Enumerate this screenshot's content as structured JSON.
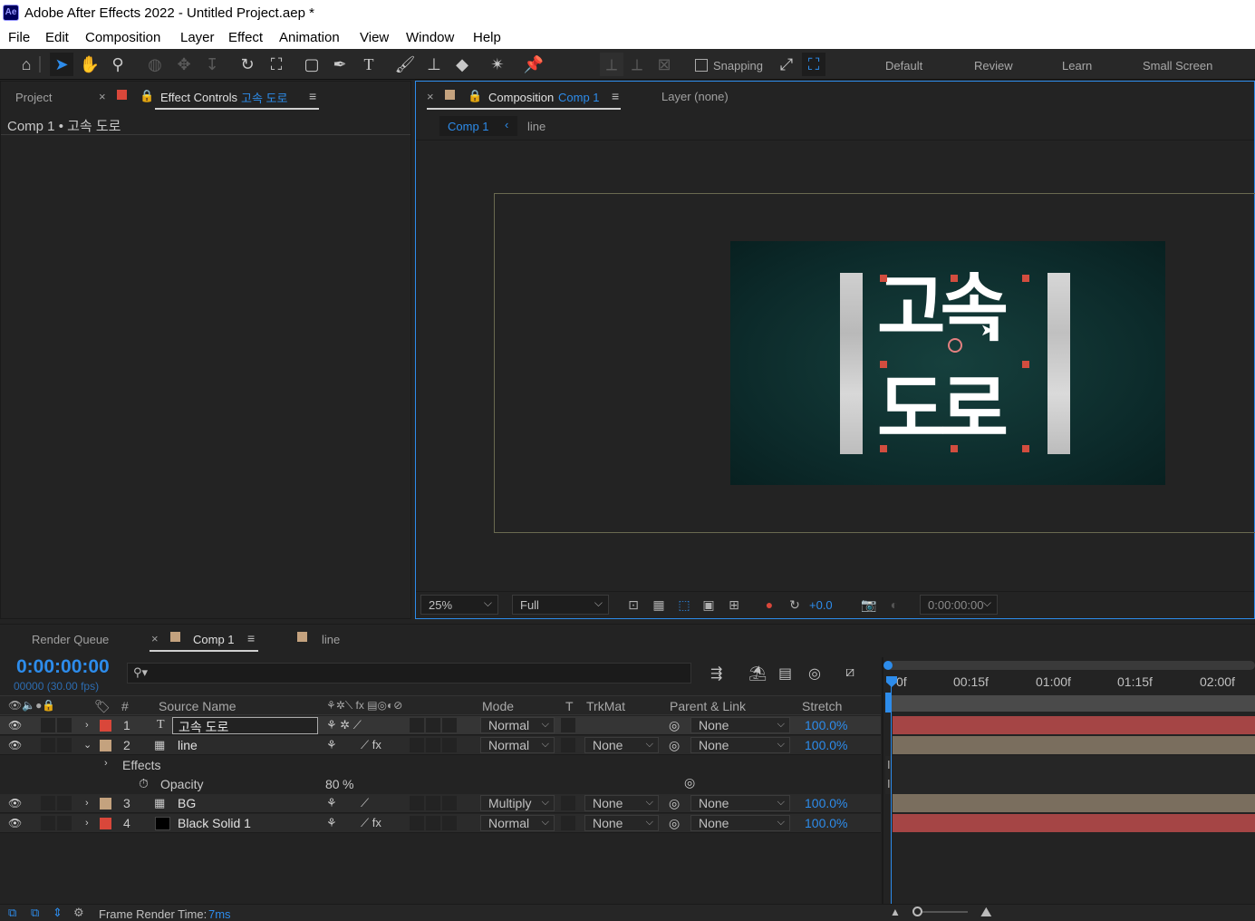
{
  "app": {
    "title": "Adobe After Effects 2022 - Untitled Project.aep *",
    "logo": "Ae"
  },
  "menu": [
    "File",
    "Edit",
    "Composition",
    "Layer",
    "Effect",
    "Animation",
    "View",
    "Window",
    "Help"
  ],
  "toolbar": {
    "snapping_label": "Snapping",
    "workspaces": [
      "Default",
      "Review",
      "Learn",
      "Small Screen"
    ]
  },
  "left_panel": {
    "tab_project": "Project",
    "tab_effect_controls": "Effect Controls",
    "effect_layer": "고속 도로",
    "breadcrumb": "Comp 1 • 고속 도로"
  },
  "comp_panel": {
    "tab_label": "Composition",
    "tab_comp": "Comp 1",
    "layer_tab": "Layer (none)",
    "crumb_active": "Comp 1",
    "crumb_next": "line",
    "canvas_text_line1": "고속",
    "canvas_text_line2": "도로",
    "zoom": "25%",
    "resolution": "Full",
    "exposure": "+0.0",
    "timecode": "0:00:00:00"
  },
  "timeline": {
    "tab_render_queue": "Render Queue",
    "tab_comp1": "Comp 1",
    "tab_line": "line",
    "current_time": "0:00:00:00",
    "frame_info": "00000 (30.00 fps)",
    "headers": {
      "num": "#",
      "source": "Source Name",
      "mode": "Mode",
      "t": "T",
      "trkmat": "TrkMat",
      "parent": "Parent & Link",
      "stretch": "Stretch"
    },
    "ruler": [
      "0f",
      "00:15f",
      "01:00f",
      "01:15f",
      "02:00f"
    ],
    "layers": [
      {
        "num": "1",
        "name": "고속 도로",
        "mode": "Normal",
        "trkmat": "",
        "parent": "None",
        "stretch": "100.0%",
        "color": "#d9473a",
        "type": "T"
      },
      {
        "num": "2",
        "name": "line",
        "mode": "Normal",
        "trkmat": "None",
        "parent": "None",
        "stretch": "100.0%",
        "color": "#c4a27e",
        "type": "comp"
      },
      {
        "num": "3",
        "name": "BG",
        "mode": "Multiply",
        "trkmat": "None",
        "parent": "None",
        "stretch": "100.0%",
        "color": "#c4a27e",
        "type": "comp"
      },
      {
        "num": "4",
        "name": "Black Solid 1",
        "mode": "Normal",
        "trkmat": "None",
        "parent": "None",
        "stretch": "100.0%",
        "color": "#d9473a",
        "type": "solid"
      }
    ],
    "effects_label": "Effects",
    "opacity_label": "Opacity",
    "opacity_value": "80",
    "opacity_unit": "%"
  },
  "status": {
    "label": "Frame Render Time:",
    "value": "7ms"
  },
  "colors": {
    "accent": "#2d8ceb",
    "red_label": "#d9473a",
    "tan_label": "#c4a27e",
    "red_bar": "#a54545",
    "tan_bar": "#7a6e5e"
  }
}
